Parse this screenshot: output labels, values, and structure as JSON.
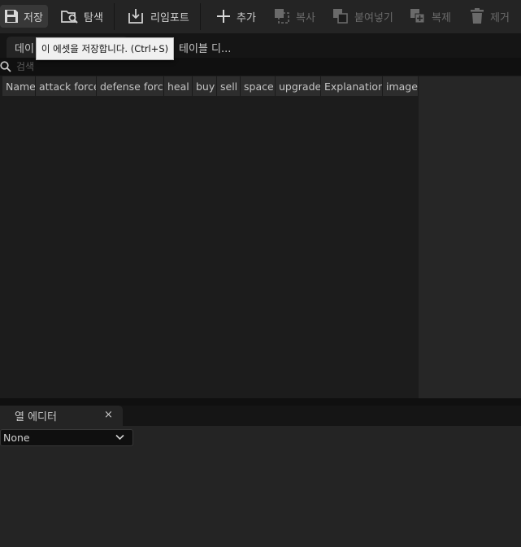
{
  "toolbar": {
    "save": "저장",
    "browse": "탐색",
    "reimport": "리임포트",
    "add": "추가",
    "copy": "복사",
    "paste": "붙여넣기",
    "duplicate": "복제",
    "remove": "제거"
  },
  "tabs": {
    "data_table": "데이",
    "table_details": "테이블 디..."
  },
  "tooltip": "이 에셋을 저장합니다. (Ctrl+S)",
  "search": {
    "placeholder": "검색",
    "value": ""
  },
  "table": {
    "columns": [
      "Name",
      "attack force",
      "defense force",
      "heal",
      "buy",
      "sell",
      "space",
      "upgrade",
      "Explanation",
      "image"
    ],
    "rows": []
  },
  "column_editor": {
    "tab_label": "열 에디터",
    "close": "×",
    "selected": "None"
  },
  "colors": {
    "background": "#1c1c1c",
    "toolbar": "#242424",
    "header": "#2d2d2d",
    "tooltip_bg": "#f0f0f0"
  }
}
